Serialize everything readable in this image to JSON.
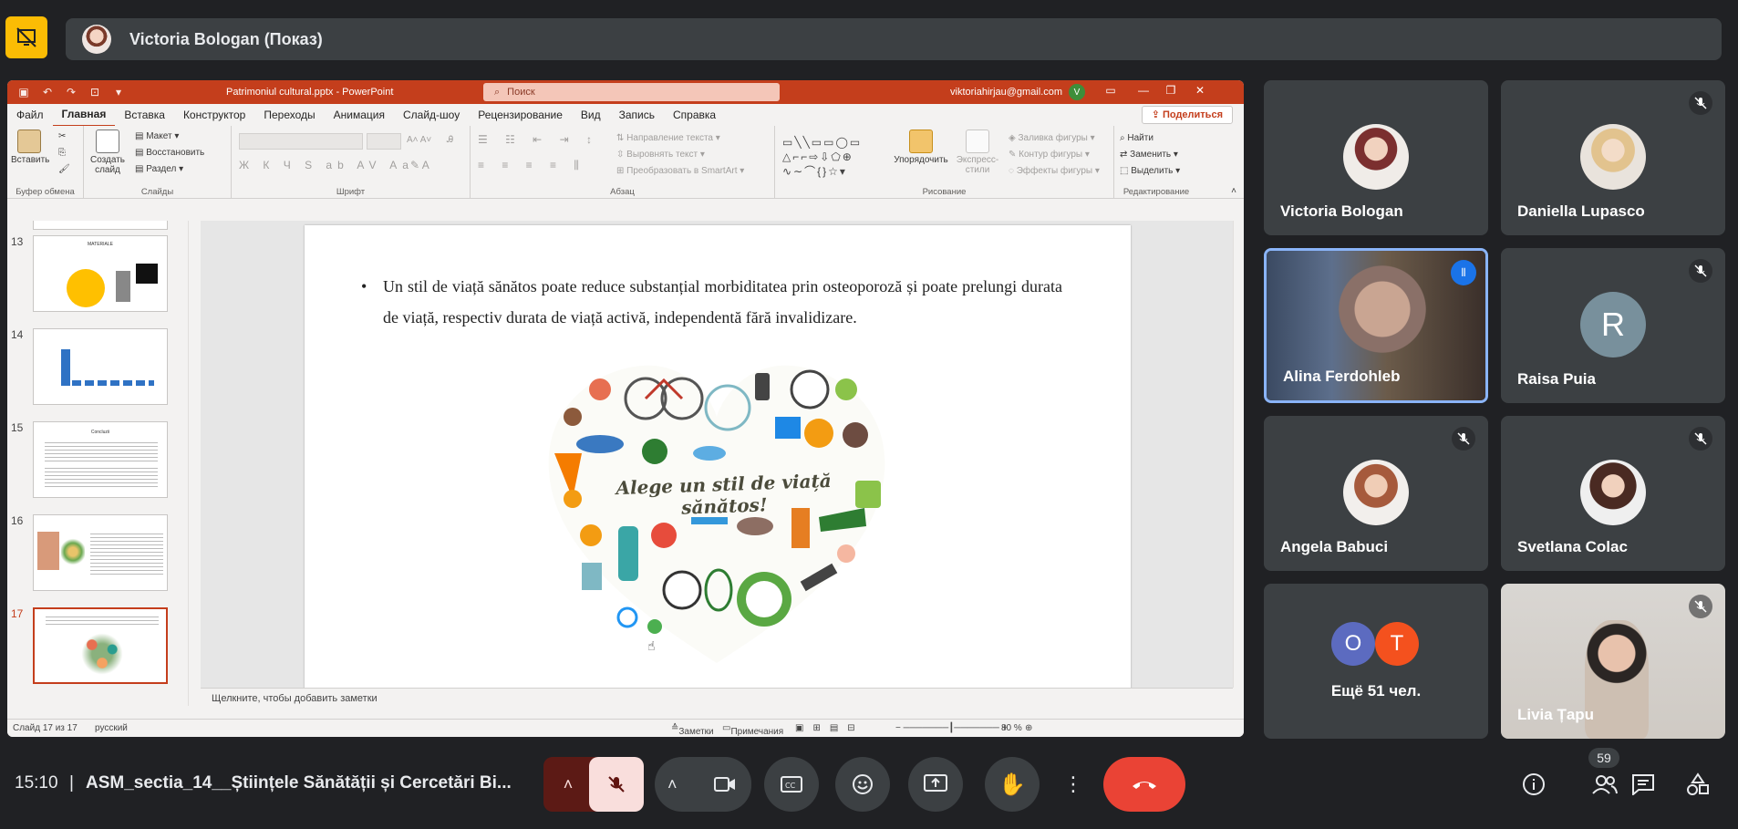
{
  "presenter": {
    "name": "Victoria Bologan (Показ)"
  },
  "ppt": {
    "filename": "Patrimoniul cultural.pptx  -  PowerPoint",
    "search_placeholder": "Поиск",
    "account": "viktoriahirjau@gmail.com",
    "account_initial": "V",
    "menu": [
      "Файл",
      "Главная",
      "Вставка",
      "Конструктор",
      "Переходы",
      "Анимация",
      "Слайд-шоу",
      "Рецензирование",
      "Вид",
      "Запись",
      "Справка"
    ],
    "share_label": "Поделиться",
    "ribbon": {
      "paste": "Вставить",
      "clipboard": "Буфер обмена",
      "new_slide": "Создать слайд",
      "layout": "Макет",
      "reset": "Восстановить",
      "section": "Раздел",
      "slides": "Слайды",
      "font": "Шрифт",
      "text_direction": "Направление текста",
      "align_text": "Выровнять текст",
      "smartart": "Преобразовать в SmartArt",
      "paragraph": "Абзац",
      "arrange": "Упорядочить",
      "quick_styles": "Экспресс-стили",
      "shape_fill": "Заливка фигуры",
      "shape_outline": "Контур фигуры",
      "shape_effects": "Эффекты фигуры",
      "drawing": "Рисование",
      "find": "Найти",
      "replace": "Заменить",
      "select": "Выделить",
      "editing": "Редактирование"
    },
    "thumbnails": [
      {
        "num": "13",
        "title": "MATERIALE"
      },
      {
        "num": "14",
        "title": ""
      },
      {
        "num": "15",
        "title": "Concluzii"
      },
      {
        "num": "16",
        "title": ""
      },
      {
        "num": "17",
        "title": ""
      }
    ],
    "slide": {
      "bullet": "Un stil de viață sănătos poate reduce substanțial morbiditatea prin osteoporoză și poate prelungi durata de viață, respectiv durata de viață activă, independentă fără invalidizare.",
      "heart_text": "Alege un stil de viață sănătos!"
    },
    "notes_placeholder": "Щелкните, чтобы добавить заметки",
    "status": {
      "slide_count": "Слайд 17 из 17",
      "language": "русский",
      "notes": "Заметки",
      "comments": "Примечания",
      "zoom": "80 %"
    }
  },
  "participants": [
    {
      "name": "Victoria Bologan",
      "muted": false,
      "type": "avatar"
    },
    {
      "name": "Daniella Lupasco",
      "muted": true,
      "type": "avatar"
    },
    {
      "name": "Alina Ferdohleb",
      "muted": false,
      "type": "video",
      "speaking": true
    },
    {
      "name": "Raisa Puia",
      "muted": true,
      "type": "letter",
      "letter": "R"
    },
    {
      "name": "Angela Babuci",
      "muted": true,
      "type": "avatar"
    },
    {
      "name": "Svetlana Colac",
      "muted": true,
      "type": "avatar"
    },
    {
      "name": "Ещё 51 чел.",
      "type": "more",
      "letters": [
        "O",
        "T"
      ]
    },
    {
      "name": "Livia Țapu",
      "muted": true,
      "type": "video"
    }
  ],
  "bottom": {
    "time": "15:10",
    "divider": "|",
    "meeting_title": "ASM_sectia_14__Științele Sănătății și Cercetări Bi...",
    "people_count": "59"
  },
  "colors": {
    "ppt_accent": "#c43e1c",
    "end_call": "#ea4335",
    "mic_off_bg": "#f9dedc",
    "speaking_border": "#8ab4f8"
  }
}
